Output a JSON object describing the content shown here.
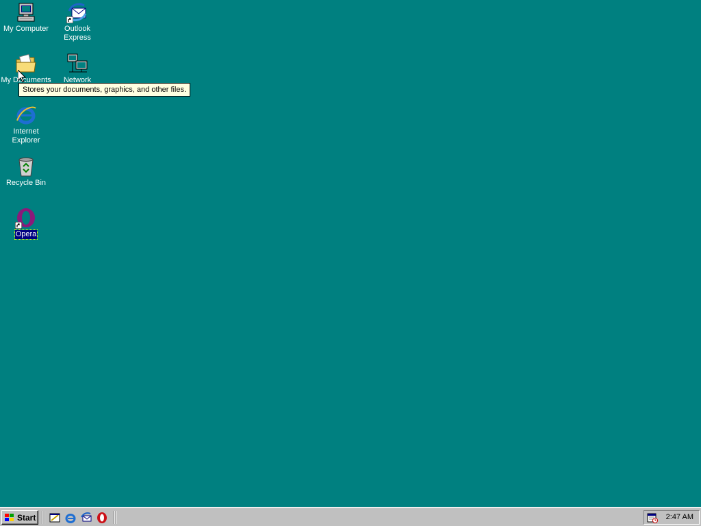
{
  "desktop": {
    "background": "#008080",
    "icons": [
      {
        "label": "My Computer",
        "icon": "my-computer-icon"
      },
      {
        "label": "Outlook\nExpress",
        "icon": "outlook-express-icon"
      },
      {
        "label": "My Documents",
        "icon": "my-documents-icon"
      },
      {
        "label": "Network\nNeighborhood",
        "icon": "network-neighborhood-icon"
      },
      {
        "label": "Internet\nExplorer",
        "icon": "internet-explorer-icon"
      },
      {
        "label": "Recycle Bin",
        "icon": "recycle-bin-icon"
      },
      {
        "label": "Opera",
        "icon": "opera-icon",
        "selected": true
      }
    ],
    "tooltip": "Stores your documents, graphics, and other files."
  },
  "taskbar": {
    "start_label": "Start",
    "quick_launch": [
      {
        "name": "show-desktop",
        "icon": "show-desktop-icon"
      },
      {
        "name": "internet-explorer",
        "icon": "internet-explorer-icon"
      },
      {
        "name": "outlook-express",
        "icon": "outlook-express-icon"
      },
      {
        "name": "opera",
        "icon": "opera-icon"
      }
    ],
    "tray": {
      "icon": "scheduler-icon",
      "clock": "2:47 AM"
    }
  }
}
